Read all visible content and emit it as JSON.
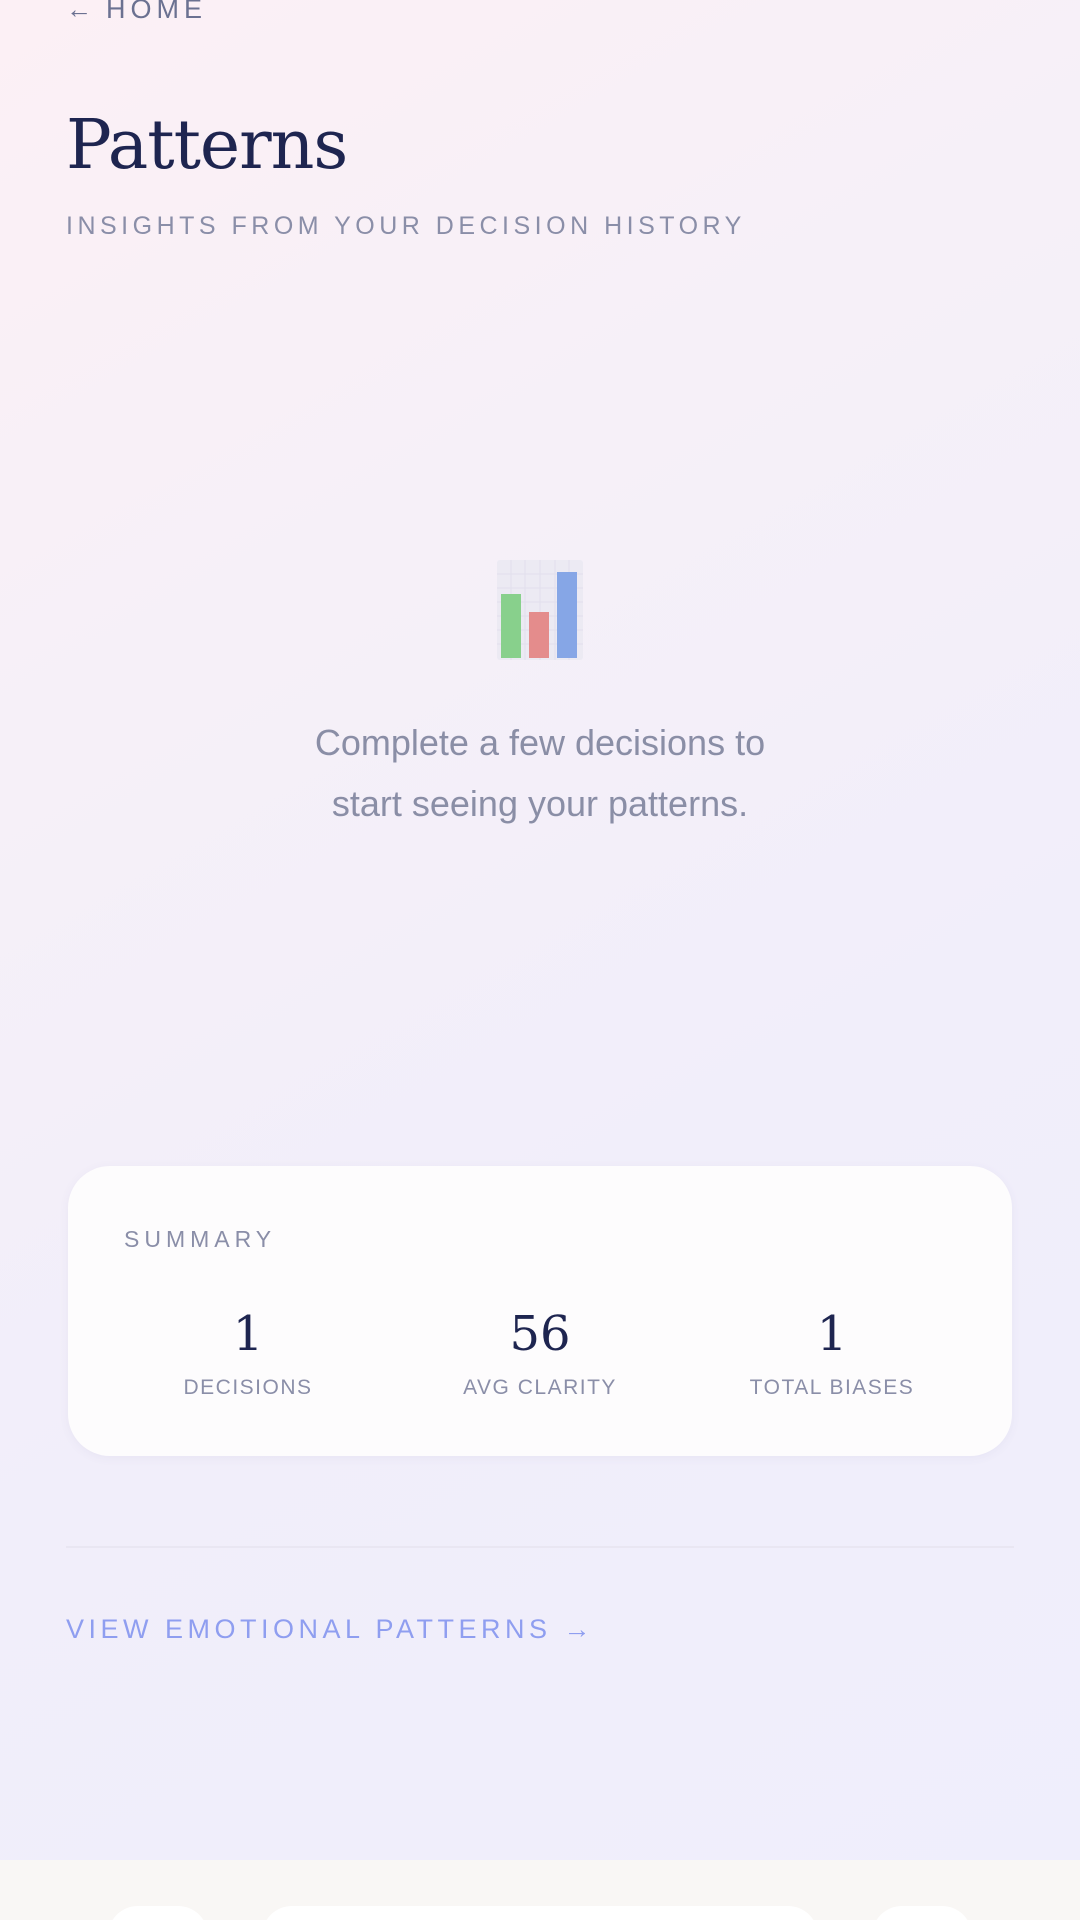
{
  "nav": {
    "back_arrow": "←",
    "back_label": "HOME"
  },
  "header": {
    "title": "Patterns",
    "subtitle": "INSIGHTS FROM YOUR DECISION HISTORY"
  },
  "empty_state": {
    "icon": "bar-chart-icon",
    "line1": "Complete a few decisions to",
    "line2": "start seeing your patterns."
  },
  "summary": {
    "label": "SUMMARY",
    "stats": [
      {
        "value": "1",
        "label": "DECISIONS"
      },
      {
        "value": "56",
        "label": "AVG CLARITY"
      },
      {
        "value": "1",
        "label": "TOTAL BIASES"
      }
    ]
  },
  "links": {
    "emotional_patterns": "VIEW EMOTIONAL PATTERNS →"
  },
  "colors": {
    "title": "#1e2550",
    "muted_text": "#8a8ea8",
    "link": "#8f9ef0",
    "bar_green": "#88d08c",
    "bar_red": "#e48c8c",
    "bar_blue": "#86a6e6"
  }
}
